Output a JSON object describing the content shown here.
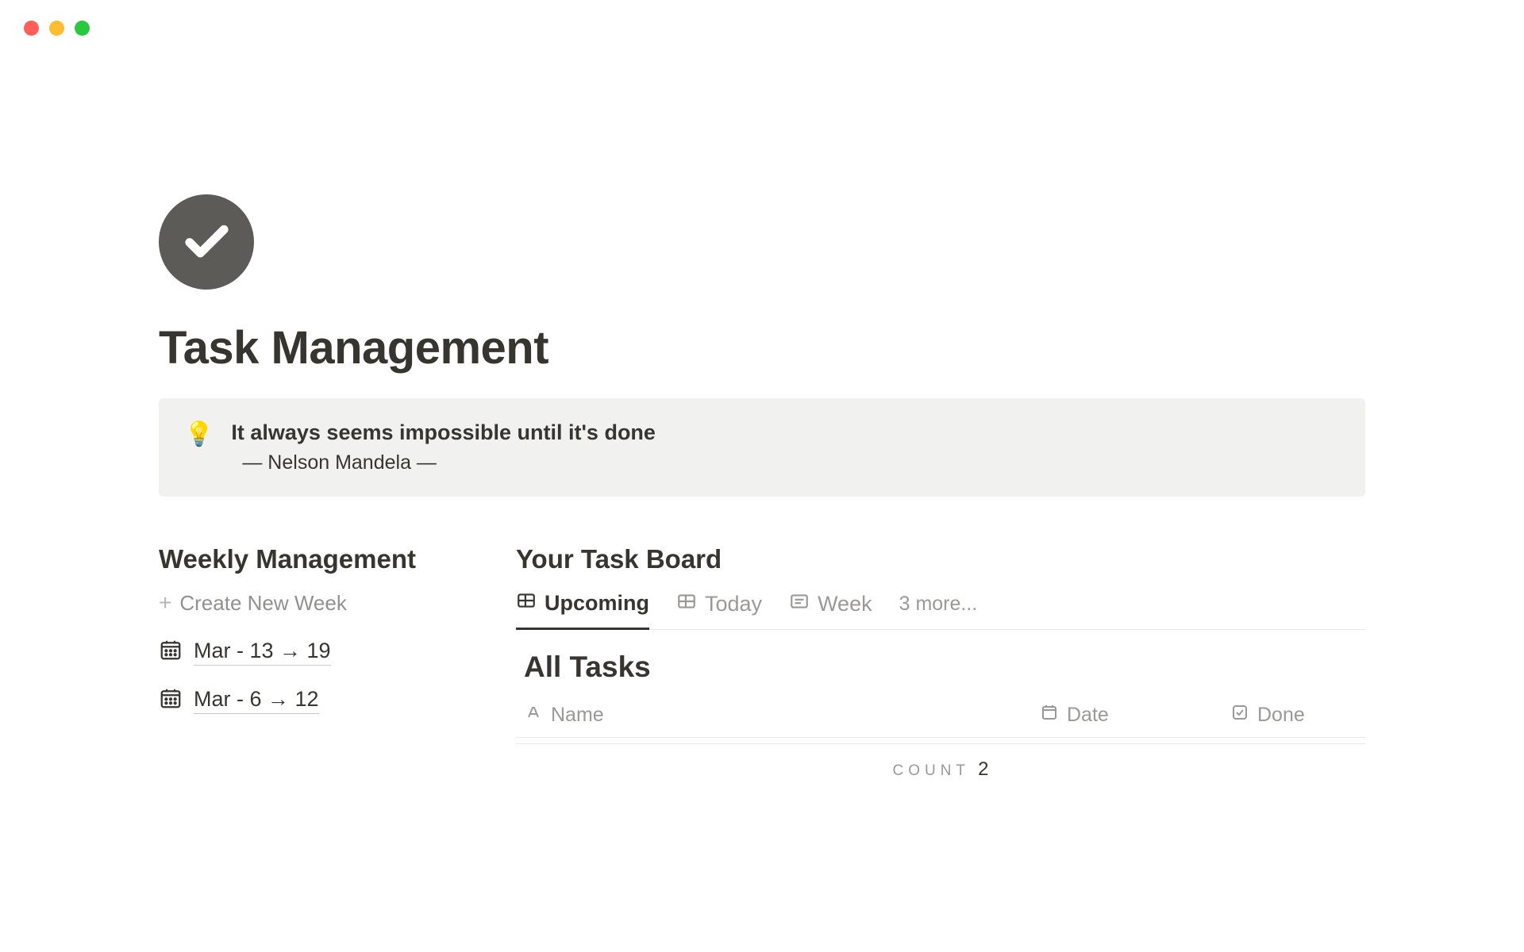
{
  "page": {
    "title": "Task Management"
  },
  "callout": {
    "icon": "💡",
    "quote": "It always seems impossible until it's done",
    "author": "— Nelson Mandela —"
  },
  "weekly": {
    "heading": "Weekly Management",
    "create_label": "Create New Week",
    "items": [
      {
        "label": "Mar - 13 → 19"
      },
      {
        "label": "Mar - 6 → 12"
      }
    ]
  },
  "board": {
    "heading": "Your Task Board",
    "tabs": [
      {
        "label": "Upcoming",
        "icon": "table",
        "active": true
      },
      {
        "label": "Today",
        "icon": "table",
        "active": false
      },
      {
        "label": "Week",
        "icon": "list",
        "active": false
      }
    ],
    "more_label": "3 more...",
    "view_title": "All Tasks",
    "columns": {
      "name": "Name",
      "date": "Date",
      "done": "Done"
    },
    "count_label": "COUNT",
    "count_value": "2"
  }
}
